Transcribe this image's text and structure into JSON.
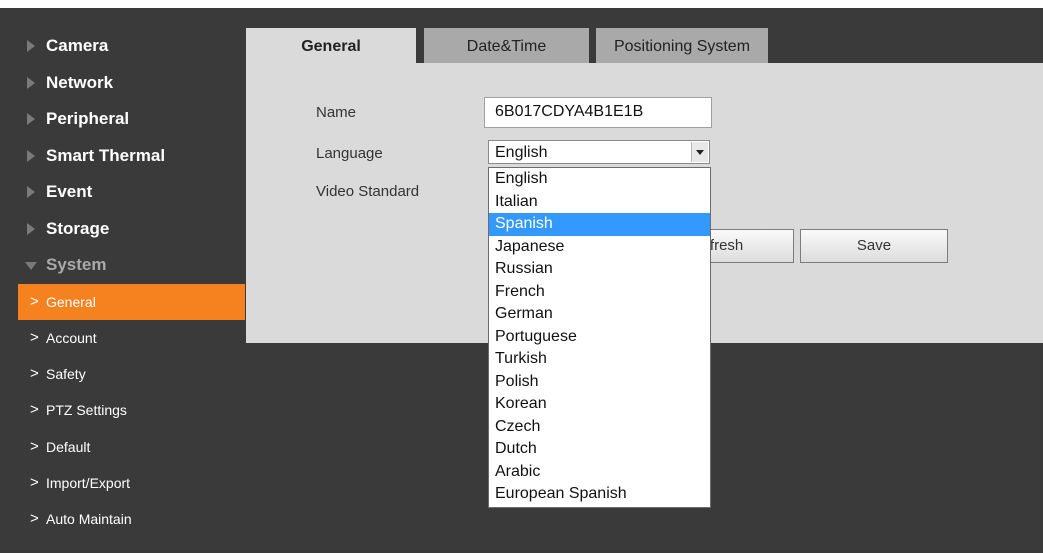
{
  "sidebar": {
    "items": [
      {
        "label": "Camera"
      },
      {
        "label": "Network"
      },
      {
        "label": "Peripheral"
      },
      {
        "label": "Smart Thermal"
      },
      {
        "label": "Event"
      },
      {
        "label": "Storage"
      },
      {
        "label": "System"
      }
    ],
    "system_subitems": [
      {
        "label": "General",
        "active": true
      },
      {
        "label": "Account"
      },
      {
        "label": "Safety"
      },
      {
        "label": "PTZ Settings"
      },
      {
        "label": "Default"
      },
      {
        "label": "Import/Export"
      },
      {
        "label": "Auto Maintain"
      }
    ]
  },
  "tabs": [
    {
      "label": "General",
      "active": true
    },
    {
      "label": "Date&Time"
    },
    {
      "label": "Positioning System"
    }
  ],
  "form": {
    "name_label": "Name",
    "name_value": "6B017CDYA4B1E1B",
    "language_label": "Language",
    "language_value": "English",
    "video_standard_label": "Video Standard"
  },
  "buttons": {
    "refresh": "Refresh",
    "save": "Save"
  },
  "language_options": [
    "English",
    "Italian",
    "Spanish",
    "Japanese",
    "Russian",
    "French",
    "German",
    "Portuguese",
    "Turkish",
    "Polish",
    "Korean",
    "Czech",
    "Dutch",
    "Arabic",
    "European Spanish"
  ],
  "highlighted_option": "Spanish",
  "colors": {
    "accent": "#f5821f",
    "highlight": "#3399ff",
    "background": "#3a3a3a",
    "panel": "#dadada"
  }
}
